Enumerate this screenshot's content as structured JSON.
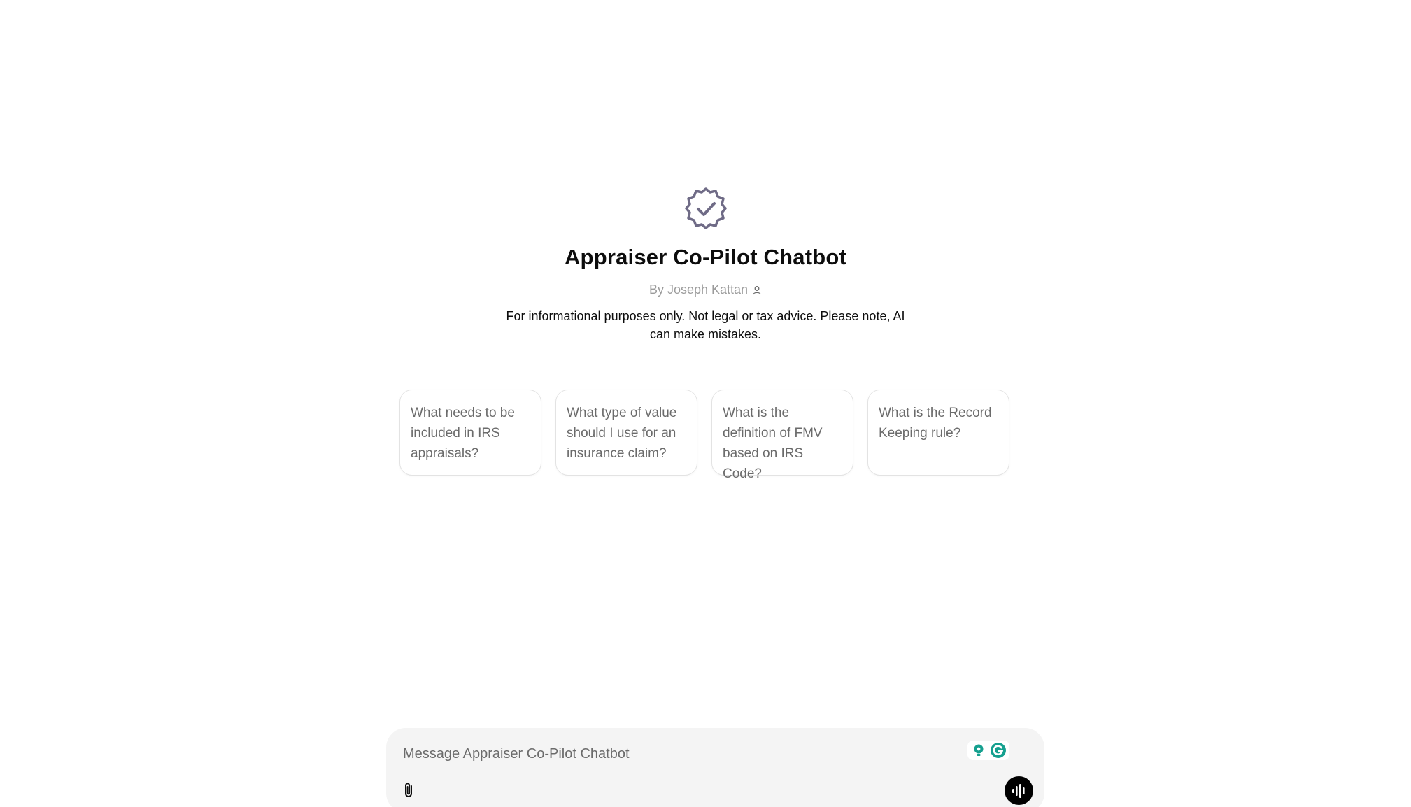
{
  "gpt": {
    "title": "Appraiser Co-Pilot Chatbot",
    "byline": "By Joseph Kattan",
    "disclaimer": "For informational purposes only. Not legal or tax advice. Please note, AI can make mistakes.",
    "badge_icon": "verified-badge-icon",
    "author_icon": "person-icon"
  },
  "starters": [
    {
      "label": "What needs to be included in IRS appraisals?"
    },
    {
      "label": "What type of value should I use for an insurance claim?"
    },
    {
      "label": "What is the definition of FMV based on IRS Code?"
    },
    {
      "label": "What is the Record Keeping rule?"
    }
  ],
  "composer": {
    "placeholder": "Message Appraiser Co-Pilot Chatbot",
    "value": "",
    "attach_icon": "paperclip-icon",
    "voice_icon": "voice-waveform-icon",
    "extension_icons": [
      "lightbulb-icon",
      "grammarly-icon"
    ]
  },
  "colors": {
    "badge": "#6f6b86",
    "composer_bg": "#f4f4f4",
    "starter_border": "#e3e3e3",
    "voice_button": "#000000",
    "extension_teal": "#15a08f"
  }
}
